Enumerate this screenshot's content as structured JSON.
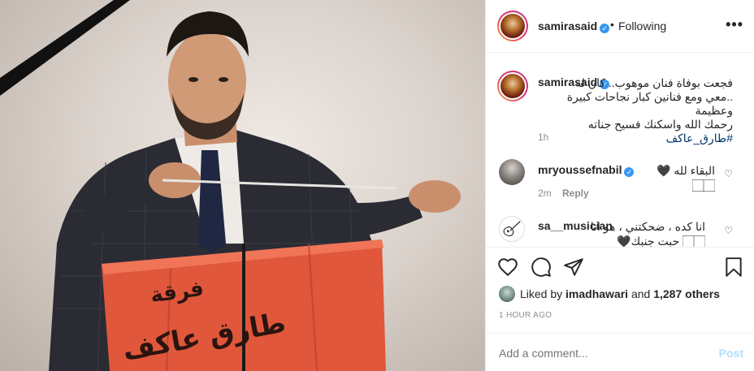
{
  "post": {
    "photo_text": {
      "line1": "فرقة",
      "line2": "طارق عاكف"
    }
  },
  "header": {
    "username": "samirasaid",
    "separator": "•",
    "follow_state": "Following",
    "more_label": "•••"
  },
  "caption": {
    "username": "samirasaid",
    "line1": "فجعت بوفاة فنان موهوب.. كان له",
    "line2": "..معي ومع فنانين كبار نجاحات كبيرة وعظيمة",
    "line3": "رحمك الله واسكنك فسيح جناته",
    "hashtag": "#طارق_عاكف",
    "time": "1h"
  },
  "comments": [
    {
      "username": "mryoussefnabil",
      "text": "البقاء لله 🖤🏻🏻",
      "time": "2m",
      "reply_label": "Reply"
    },
    {
      "username": "sa__musician",
      "line1": "انا كده ، ضحكتني ، هو انا",
      "line2": "🏻🏻 حبت جنبك🖤"
    }
  ],
  "likes": {
    "prefix": "Liked by ",
    "user": "imadhawari",
    "middle": " and ",
    "count": "1,287 others"
  },
  "timestamp": "1 HOUR AGO",
  "add_comment": {
    "placeholder": "Add a comment...",
    "post_label": "Post"
  },
  "colors": {
    "verified": "#3897f0",
    "hashtag": "#00376b",
    "post_disabled": "#b2dffc",
    "muted": "#8e8e8e"
  }
}
